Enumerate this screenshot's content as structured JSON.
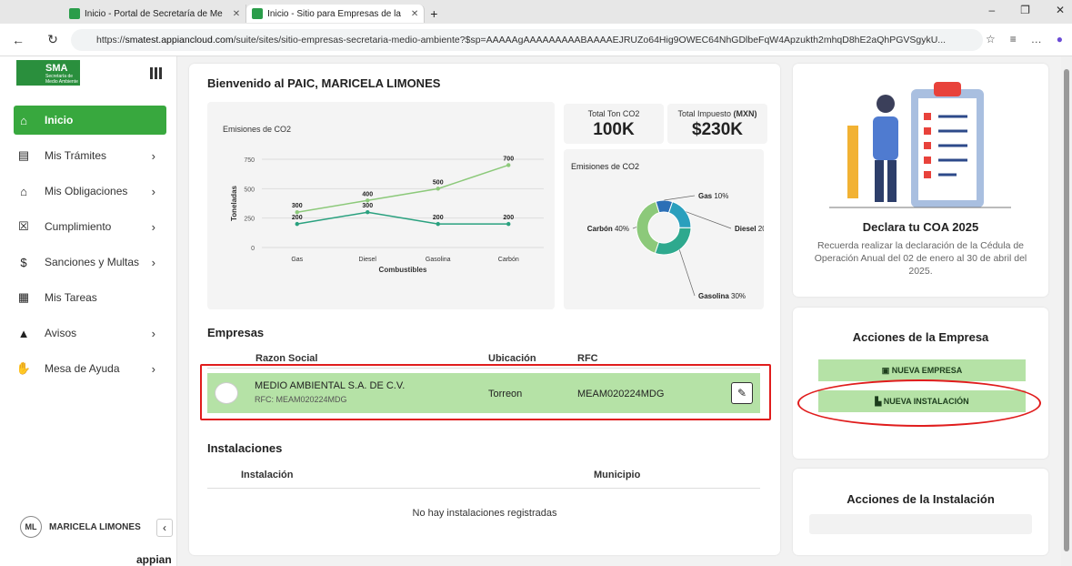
{
  "browser": {
    "tabs": [
      {
        "title": "Inicio - Portal de Secretaría de Me"
      },
      {
        "title": "Inicio - Sitio para Empresas de la"
      }
    ],
    "url_prefix": "https://",
    "url_host": "smatest.appiancloud.com",
    "url_path": "/suite/sites/sitio-empresas-secretaria-medio-ambiente?$sp=AAAAAgAAAAAAAAABAAAAEJRUZo64Hig9OWEC64NhGDlbeFqW4Apzukth2mhqD8hE2aQhPGVSgykU..."
  },
  "sidebar": {
    "logo_text": "SMA",
    "logo_sub": "Secretaría de Medio Ambiente",
    "items": [
      {
        "label": "Inicio",
        "icon": "home-icon",
        "active": true
      },
      {
        "label": "Mis Trámites",
        "icon": "document-icon",
        "chevron": true
      },
      {
        "label": "Mis Obligaciones",
        "icon": "institution-icon",
        "chevron": true
      },
      {
        "label": "Cumplimiento",
        "icon": "cumplimiento-icon",
        "chevron": true
      },
      {
        "label": "Sanciones y Multas",
        "icon": "money-icon",
        "chevron": true
      },
      {
        "label": "Mis Tareas",
        "icon": "briefcase-icon"
      },
      {
        "label": "Avisos",
        "icon": "warning-icon",
        "chevron": true
      },
      {
        "label": "Mesa de Ayuda",
        "icon": "handshake-icon",
        "chevron": true
      }
    ],
    "user_initials": "ML",
    "user_name": "MARICELA LIMONES",
    "brand": "appian"
  },
  "main": {
    "welcome": "Bienvenido al PAIC, MARICELA LIMONES",
    "kpis": [
      {
        "label": "Total Ton CO2",
        "label_bold": "",
        "value": "100K"
      },
      {
        "label": "Total Impuesto ",
        "label_bold": "(MXN)",
        "value": "$230K"
      }
    ],
    "companies_title": "Empresas",
    "companies_cols": [
      "Razon Social",
      "Ubicación",
      "RFC"
    ],
    "company": {
      "name": "MEDIO AMBIENTAL S.A. DE C.V.",
      "rfc_line": "RFC: MEAM020224MDG",
      "location": "Torreon",
      "rfc": "MEAM020224MDG"
    },
    "installations_title": "Instalaciones",
    "installations_cols": [
      "Instalación",
      "Municipio"
    ],
    "installations_empty": "No hay instalaciones registradas"
  },
  "chart_data": [
    {
      "type": "line",
      "title": "Emisiones de CO2",
      "xlabel": "Combustibles",
      "ylabel": "Toneladas",
      "categories": [
        "Gas",
        "Diesel",
        "Gasolina",
        "Carbón"
      ],
      "ylim": [
        0,
        750
      ],
      "yticks": [
        0,
        250,
        500,
        750
      ],
      "series": [
        {
          "values": [
            300,
            400,
            500,
            700
          ],
          "color": "#8cc97a"
        },
        {
          "values": [
            200,
            300,
            200,
            200
          ],
          "color": "#2aa17f"
        }
      ]
    },
    {
      "type": "pie",
      "title": "Emisiones de CO2",
      "slices": [
        {
          "label": "Gas",
          "pct": "10%",
          "value": 10,
          "color": "#2b6fb6"
        },
        {
          "label": "Diesel",
          "pct": "20",
          "value": 20,
          "color": "#2a9fbd"
        },
        {
          "label": "Gasolina",
          "pct": "30%",
          "value": 30,
          "color": "#2ea98e"
        },
        {
          "label": "Carbón",
          "pct": "40%",
          "value": 40,
          "color": "#8cc97a"
        }
      ]
    }
  ],
  "right": {
    "coa_title": "Declara tu COA 2025",
    "coa_desc": "Recuerda realizar la declaración de la Cédula de Operación Anual del 02 de enero al 30 de abril del 2025.",
    "company_actions_title": "Acciones de la Empresa",
    "btn_new_company": "NUEVA EMPRESA",
    "btn_new_installation": "NUEVA INSTALACIÓN",
    "installation_actions_title": "Acciones de la Instalación"
  }
}
